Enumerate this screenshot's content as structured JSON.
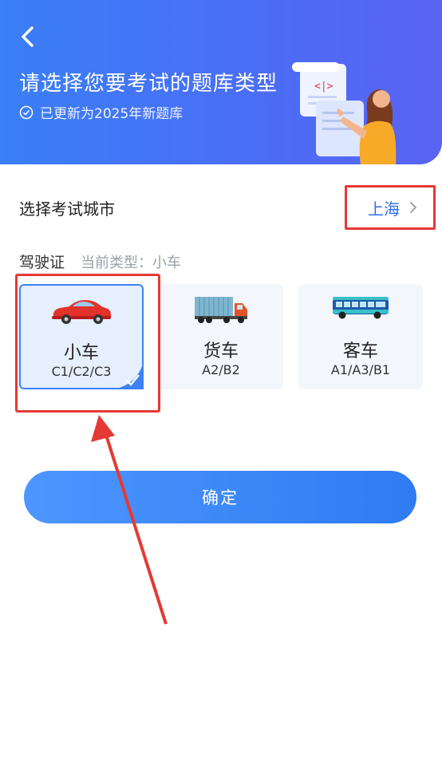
{
  "header": {
    "title": "请选择您要考试的题库类型",
    "subtitle": "已更新为2025年新题库"
  },
  "city": {
    "label": "选择考试城市",
    "value": "上海"
  },
  "license": {
    "label": "驾驶证",
    "current_type": "当前类型：小车"
  },
  "vehicles": [
    {
      "name": "小车",
      "codes": "C1/C2/C3",
      "selected": true,
      "icon": "car-icon"
    },
    {
      "name": "货车",
      "codes": "A2/B2",
      "selected": false,
      "icon": "truck-icon"
    },
    {
      "name": "客车",
      "codes": "A1/A3/B1",
      "selected": false,
      "icon": "bus-icon"
    }
  ],
  "confirm_label": "确定",
  "colors": {
    "header_gradient_start": "#3a7ff6",
    "header_gradient_end": "#5a63f2",
    "accent": "#2f6ee6",
    "annotation_red": "#e53935"
  }
}
